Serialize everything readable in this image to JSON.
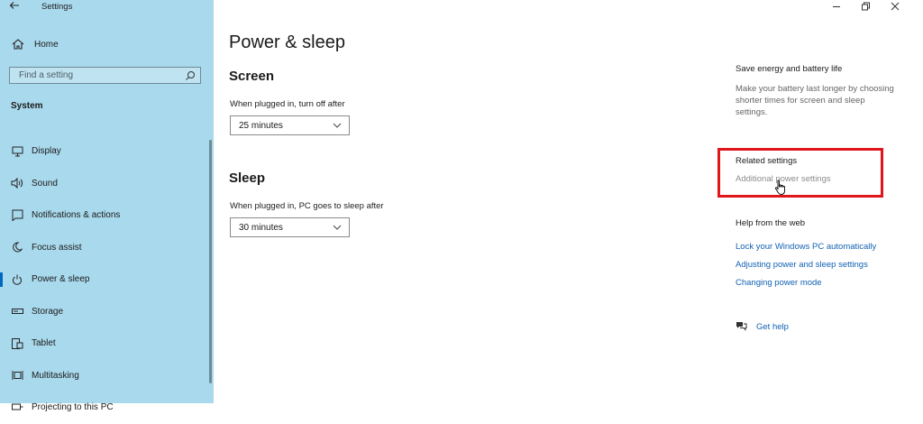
{
  "window": {
    "app_title": "Settings",
    "controls": [
      "minimize",
      "restore",
      "close"
    ]
  },
  "sidebar": {
    "back_icon": "arrow-left-icon",
    "home_label": "Home",
    "search_placeholder": "Find a setting",
    "section_title": "System",
    "items": [
      {
        "label": "Display",
        "icon": "monitor-icon",
        "active": false
      },
      {
        "label": "Sound",
        "icon": "speaker-icon",
        "active": false
      },
      {
        "label": "Notifications & actions",
        "icon": "notification-icon",
        "active": false
      },
      {
        "label": "Focus assist",
        "icon": "moon-icon",
        "active": false
      },
      {
        "label": "Power & sleep",
        "icon": "power-icon",
        "active": true
      },
      {
        "label": "Storage",
        "icon": "storage-icon",
        "active": false
      },
      {
        "label": "Tablet",
        "icon": "tablet-icon",
        "active": false
      },
      {
        "label": "Multitasking",
        "icon": "multitasking-icon",
        "active": false
      },
      {
        "label": "Projecting to this PC",
        "icon": "projector-icon",
        "active": false
      }
    ]
  },
  "main": {
    "title": "Power & sleep",
    "screen": {
      "heading": "Screen",
      "label": "When plugged in, turn off after",
      "value": "25 minutes"
    },
    "sleep": {
      "heading": "Sleep",
      "label": "When plugged in, PC goes to sleep after",
      "value": "30 minutes"
    }
  },
  "right": {
    "save_energy": {
      "heading": "Save energy and battery life",
      "description": "Make your battery last longer by choosing shorter times for screen and sleep settings."
    },
    "related": {
      "heading": "Related settings",
      "link": "Additional power settings"
    },
    "help": {
      "heading": "Help from the web",
      "links": [
        "Lock your Windows PC automatically",
        "Adjusting power and sleep settings",
        "Changing power mode"
      ],
      "get_help": "Get help"
    }
  },
  "colors": {
    "sidebar_bg": "#a9d9ec",
    "accent": "#0067c0",
    "link": "#1262b3",
    "highlight": "#e0161b"
  }
}
